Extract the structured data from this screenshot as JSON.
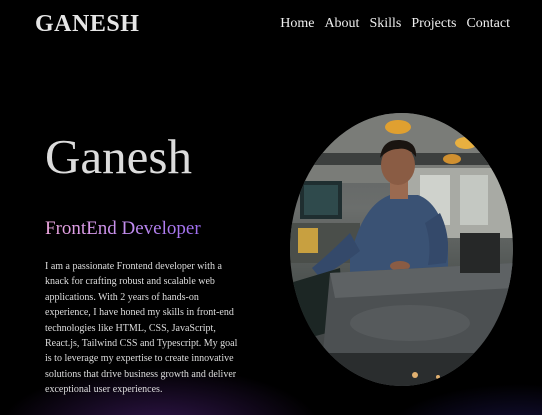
{
  "brand": {
    "logo": "GANESH"
  },
  "nav": {
    "items": [
      {
        "label": "Home"
      },
      {
        "label": "About"
      },
      {
        "label": "Skills"
      },
      {
        "label": "Projects"
      },
      {
        "label": "Contact"
      }
    ]
  },
  "hero": {
    "name": "Ganesh",
    "role": "FrontEnd Developer",
    "bio": "I am a passionate Frontend developer with a knack for crafting robust and scalable web applications. With 2 years of hands-on experience, I have honed my skills in front-end technologies like HTML, CSS, JavaScript, React.js, Tailwind CSS and Typescript. My goal is to leverage my expertise to create innovative solutions that drive business growth and deliver exceptional user experiences."
  },
  "colors": {
    "background": "#000000",
    "role_gradient_start": "#f0a8e0",
    "role_gradient_end": "#9d6cf0",
    "glow": "#5a288c"
  }
}
